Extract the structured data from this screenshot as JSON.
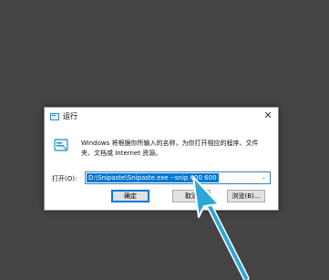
{
  "dialog": {
    "title": "运行",
    "description": "Windows 将根据你所输入的名称，为你打开相应的程序、文件夹、文档或 Internet 资源。",
    "open_label": "打开(O):",
    "command_value": "D:\\Snipaste\\Snipaste.exe --snip 600 600",
    "ok_label": "确定",
    "cancel_label": "取消",
    "browse_label": "浏览(B)...",
    "close_symbol": "✕",
    "dropdown_symbol": "⌄"
  },
  "icons": {
    "title_icon": "run-icon",
    "main_icon": "run-icon",
    "pointer": "pointer-arrow-icon"
  },
  "colors": {
    "desktop_background": "#444444",
    "selection": "#0078d7",
    "annotation_arrow": "#2ea6d8"
  }
}
